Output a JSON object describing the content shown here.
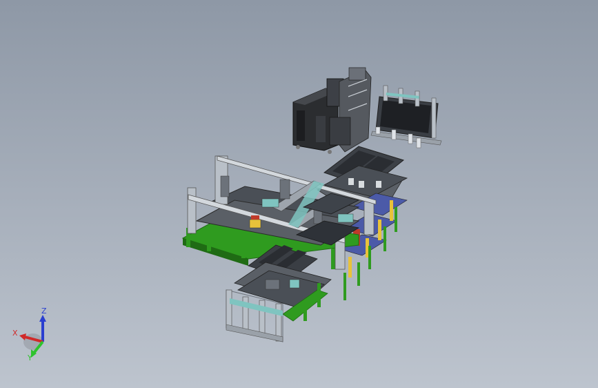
{
  "view": {
    "background_top": "#8e98a6",
    "background_bottom": "#bdc4ce"
  },
  "colors": {
    "frame_green": "#2f9b1f",
    "frame_green_dark": "#1f6b14",
    "steel_light": "#b9c0c8",
    "steel_dark": "#6c727a",
    "plate_dark": "#4a4f56",
    "plate_darker": "#2e3238",
    "machine_black": "#2b2d30",
    "teal": "#7fc4c0",
    "yellow": "#e8c23a",
    "red": "#c03a2a",
    "blue_panel": "#4b5aa8"
  },
  "triad": {
    "x_label": "X",
    "y_label": "Y",
    "z_label": "Z",
    "x_color": "#d02a2a",
    "y_color": "#2ec32e",
    "z_color": "#2a3fd0"
  }
}
